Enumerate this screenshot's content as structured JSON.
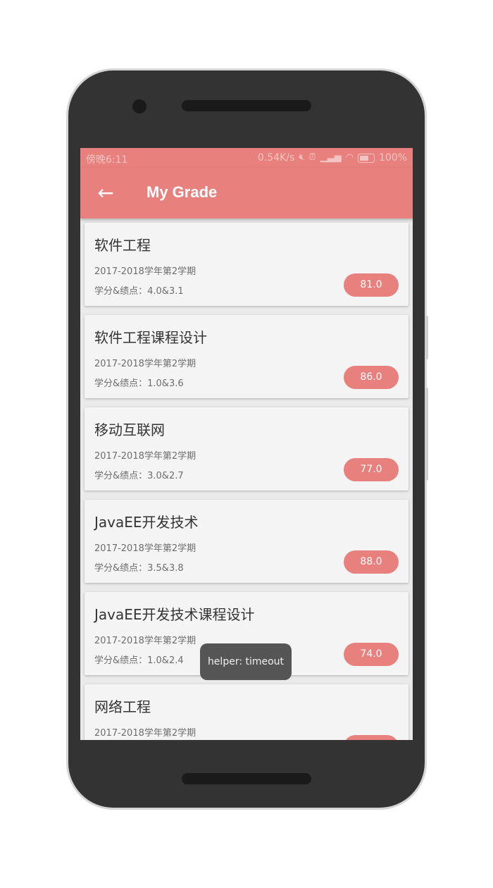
{
  "status_bar": {
    "time": "傍晚6:11",
    "network_speed": "0.54K/s",
    "battery": "100%",
    "icons": [
      "mute-icon",
      "alarm-icon",
      "signal-icon",
      "wifi-icon",
      "battery-icon"
    ]
  },
  "app_bar": {
    "back_icon": "arrow-left-icon",
    "title": "My Grade"
  },
  "grades": [
    {
      "course": "软件工程",
      "term": "2017-2018学年第2学期",
      "credit": "学分&绩点：4.0&3.1",
      "score": "81.0"
    },
    {
      "course": "软件工程课程设计",
      "term": "2017-2018学年第2学期",
      "credit": "学分&绩点：1.0&3.6",
      "score": "86.0"
    },
    {
      "course": "移动互联网",
      "term": "2017-2018学年第2学期",
      "credit": "学分&绩点：3.0&2.7",
      "score": "77.0"
    },
    {
      "course": "JavaEE开发技术",
      "term": "2017-2018学年第2学期",
      "credit": "学分&绩点：3.5&3.8",
      "score": "88.0"
    },
    {
      "course": "JavaEE开发技术课程设计",
      "term": "2017-2018学年第2学期",
      "credit": "学分&绩点：1.0&2.4",
      "score": "74.0"
    },
    {
      "course": "网络工程",
      "term": "2017-2018学年第2学期",
      "credit": "",
      "score": ""
    }
  ],
  "toast": "helper: timeout",
  "colors": {
    "accent": "#e8807e",
    "card_bg": "#f4f4f4",
    "phone_body": "#333333"
  }
}
